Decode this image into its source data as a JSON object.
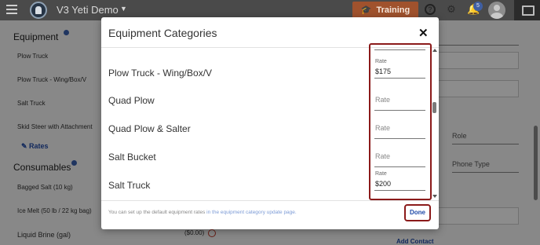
{
  "topbar": {
    "title": "V3 Yeti Demo",
    "training_label": "Training",
    "notification_count": "5"
  },
  "page": {
    "equipment_heading": "Equipment",
    "equipment_items": [
      "Plow Truck",
      "Plow Truck - Wing/Box/V",
      "Salt Truck",
      "Skid Steer with Attachment"
    ],
    "rates_link": "Rates",
    "consumables_heading": "Consumables",
    "consumable_items": [
      "Bagged Salt (10 kg)",
      "Ice Melt (50 lb / 22 kg bag)",
      "Liquid Brine (gal)"
    ],
    "role_label": "Role",
    "phone_type_label": "Phone Type",
    "price_value": "($0.00)",
    "add_contact": "Add Contact"
  },
  "modal": {
    "title": "Equipment Categories",
    "close_icon": "close-icon",
    "rate_label": "Rate",
    "categories": [
      {
        "name": "Plow Truck - Wing/Box/V",
        "rate": "$175"
      },
      {
        "name": "Quad Plow",
        "rate": ""
      },
      {
        "name": "Quad Plow & Salter",
        "rate": ""
      },
      {
        "name": "Salt Bucket",
        "rate": ""
      },
      {
        "name": "Salt Truck",
        "rate": "$200"
      }
    ],
    "footer_text": "You can set up the default equipment rates ",
    "footer_link": "in the equipment category update page.",
    "done_label": "Done"
  },
  "colors": {
    "accent_blue": "#1f4aa8",
    "highlight_red": "#8b1a1a",
    "training_orange": "#a0522d"
  }
}
